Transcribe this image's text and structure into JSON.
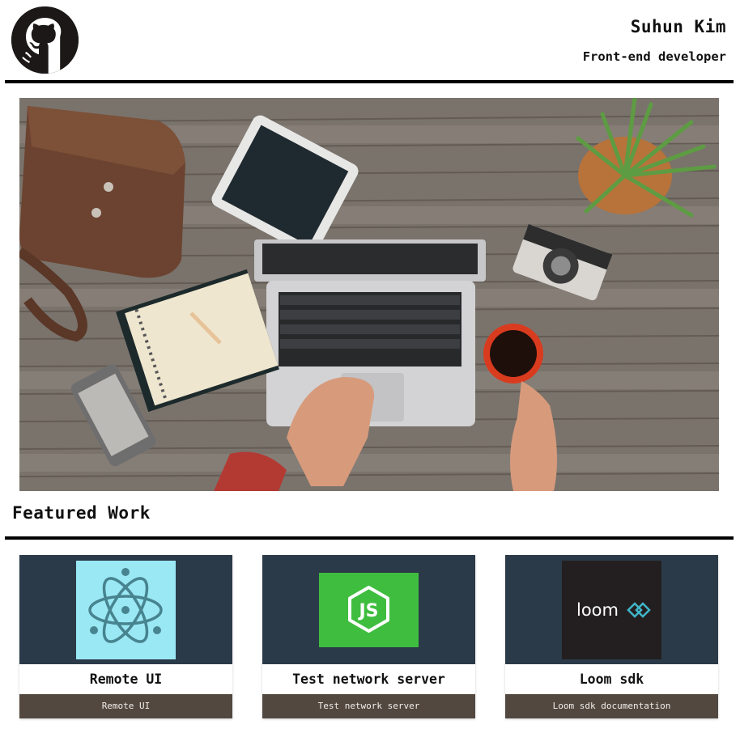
{
  "header": {
    "name": "Suhun Kim",
    "role": "Front-end developer"
  },
  "section": {
    "title": "Featured Work"
  },
  "projects": [
    {
      "title": "Remote UI",
      "caption": "Remote UI",
      "logo_text": ""
    },
    {
      "title": "Test network server",
      "caption": "Test network server",
      "logo_text": "JS"
    },
    {
      "title": "Loom sdk",
      "caption": "Loom sdk documentation",
      "logo_text": "loom"
    }
  ],
  "colors": {
    "card_thumb_bg": "#2b3a48",
    "caption_bg": "#524840",
    "rule": "#000000"
  },
  "icons": {
    "logo": "github-octocat-icon",
    "project_1": "electron-logo-icon",
    "project_2": "nodejs-logo-icon",
    "project_3": "loom-logo-icon"
  }
}
